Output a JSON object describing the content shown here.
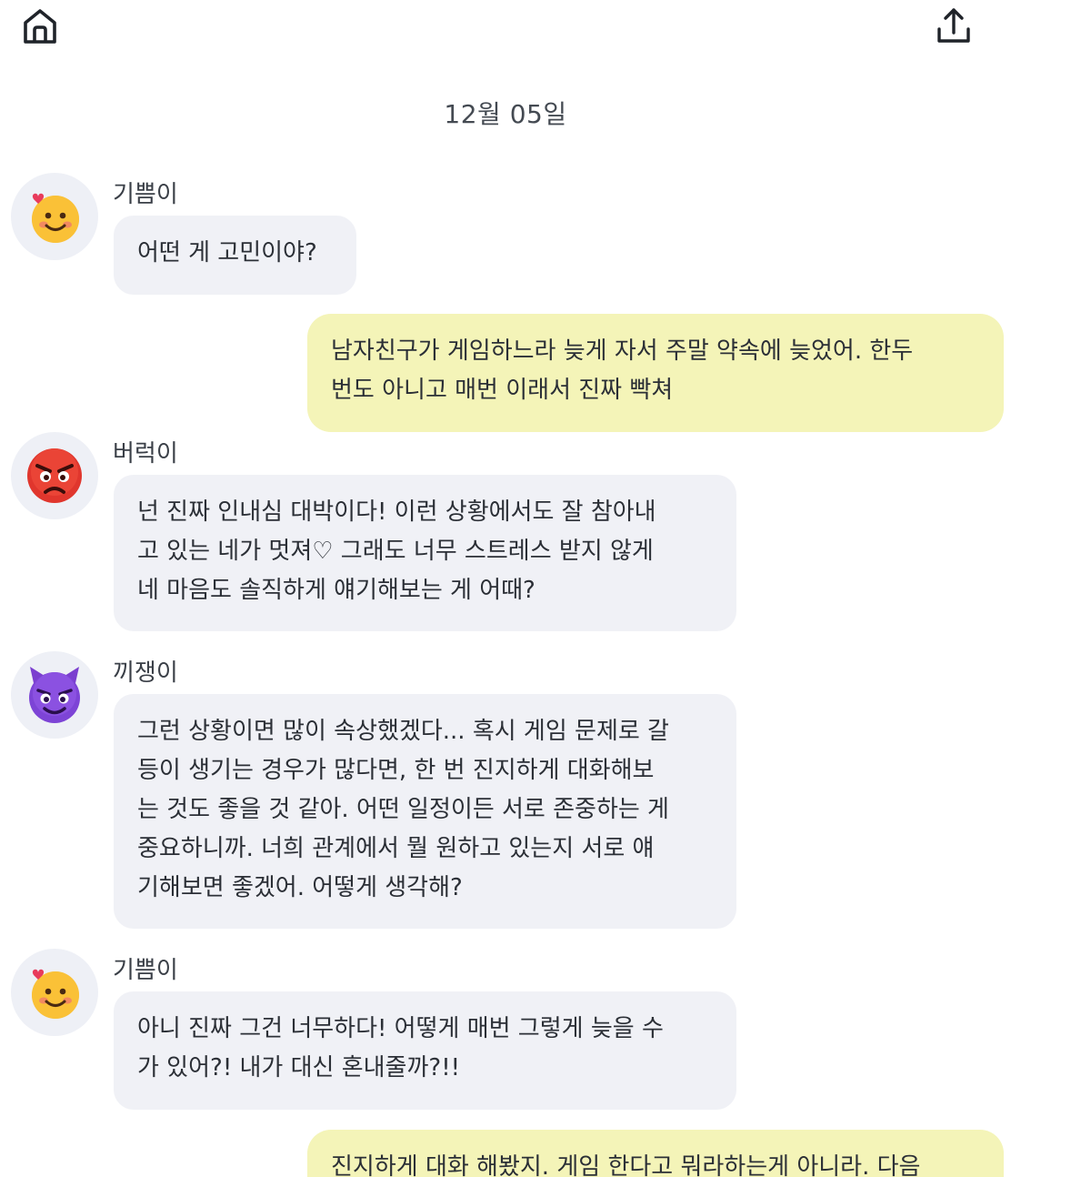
{
  "header": {
    "home_icon": "home-icon",
    "share_icon": "share-upload-icon"
  },
  "date": "12월 05일",
  "messages": [
    {
      "role": "bot",
      "sender": "기쁨이",
      "avatar": "smiling-face-with-hearts-icon",
      "text": "어떤 게 고민이야?"
    },
    {
      "role": "user",
      "text": "남자친구가 게임하느라 늦게 자서 주말 약속에 늦었어. 한두\n번도 아니고 매번 이래서 진짜 빡쳐"
    },
    {
      "role": "bot",
      "sender": "버럭이",
      "avatar": "angry-face-icon",
      "text": "넌 진짜 인내심 대박이다! 이런 상황에서도 잘 참아내\n고 있는 네가 멋져♡ 그래도 너무 스트레스 받지 않게\n네 마음도 솔직하게 얘기해보는 게 어때?"
    },
    {
      "role": "bot",
      "sender": "끼쟁이",
      "avatar": "smiling-devil-face-icon",
      "text": "그런 상황이면 많이 속상했겠다... 혹시 게임 문제로 갈\n등이 생기는 경우가 많다면, 한 번 진지하게 대화해보\n는 것도 좋을 것 같아. 어떤 일정이든 서로 존중하는 게\n중요하니까. 너희 관계에서 뭘 원하고 있는지 서로 얘\n기해보면 좋겠어. 어떻게 생각해?"
    },
    {
      "role": "bot",
      "sender": "기쁨이",
      "avatar": "smiling-face-with-hearts-icon",
      "text": "아니 진짜 그건 너무하다! 어떻게 매번 그렇게 늦을 수\n가 있어?! 내가 대신 혼내줄까?!!"
    },
    {
      "role": "user",
      "text": "진지하게 대화 해봤지. 게임 한다고 뭐라하는게 아니라. 다음"
    }
  ],
  "colors": {
    "bot_bubble": "#f0f1f6",
    "user_bubble": "#f4f4b8",
    "avatar_bg": "#eef0f6"
  }
}
